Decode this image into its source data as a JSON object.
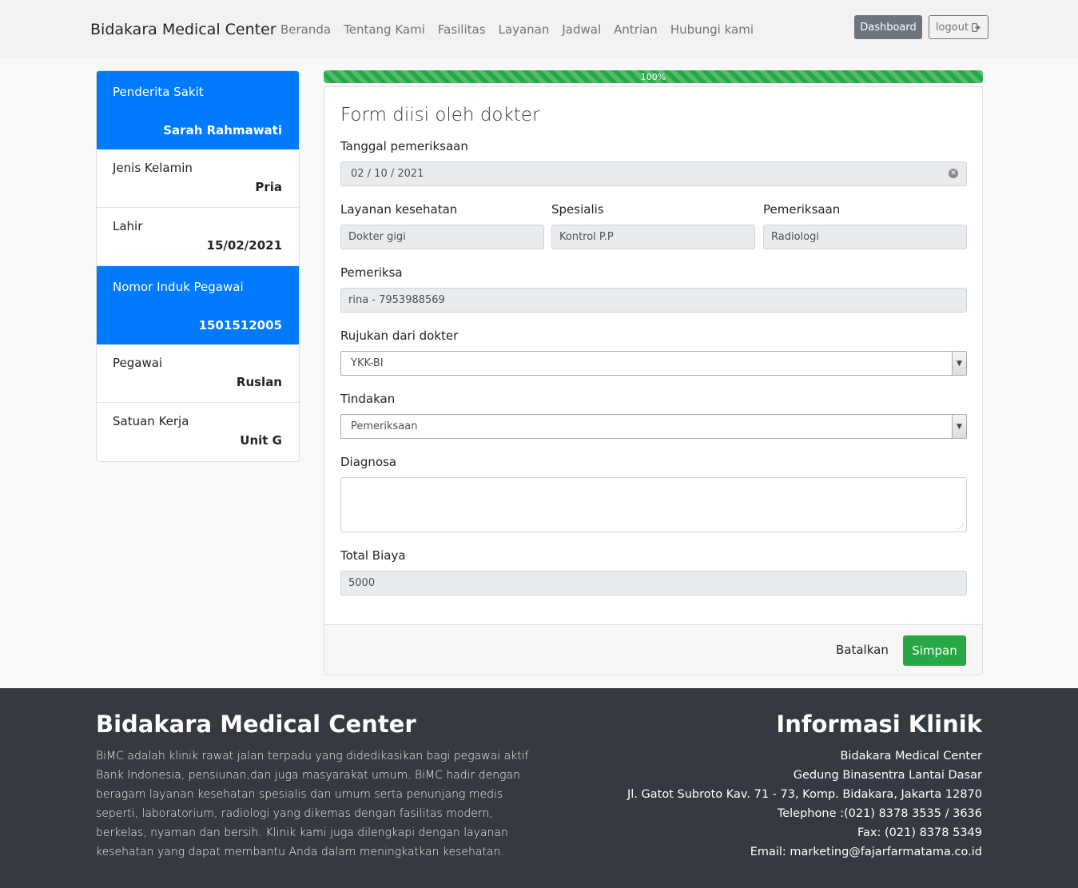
{
  "navbar": {
    "brand": "Bidakara Medical Center",
    "links": [
      "Beranda",
      "Tentang Kami",
      "Fasilitas",
      "Layanan",
      "Jadwal",
      "Antrian",
      "Hubungi kami"
    ],
    "dashboard_label": "Dashboard",
    "logout_label": "logout",
    "logout_icon": "sign-out-icon"
  },
  "sidebar": {
    "patient_label": "Penderita Sakit",
    "patient_value": "Sarah Rahmawati",
    "gender_label": "Jenis Kelamin",
    "gender_value": "Pria",
    "birth_label": "Lahir",
    "birth_value": "15/02/2021",
    "nip_label": "Nomor Induk Pegawai",
    "nip_value": "1501512005",
    "employee_label": "Pegawai",
    "employee_value": "Ruslan",
    "unit_label": "Satuan Kerja",
    "unit_value": "Unit G"
  },
  "progress": {
    "value": 100,
    "label": "100%"
  },
  "form": {
    "title": "Form diisi oleh dokter",
    "exam_date_label": "Tanggal pemeriksaan",
    "exam_date_value": "02 / 10 / 2021",
    "service_label": "Layanan kesehatan",
    "service_value": "Dokter gigi",
    "specialist_label": "Spesialis",
    "specialist_value": "Kontrol P.P",
    "examination_label": "Pemeriksaan",
    "examination_value": "Radiologi",
    "examiner_label": "Pemeriksa",
    "examiner_value": "rina - 7953988569",
    "referral_label": "Rujukan dari dokter",
    "referral_value": "YKK-BI",
    "action_label": "Tindakan",
    "action_value": "Pemeriksaan",
    "diagnosis_label": "Diagnosa",
    "diagnosis_value": "",
    "cost_label": "Total Biaya",
    "cost_value": "5000",
    "cancel_label": "Batalkan",
    "save_label": "Simpan"
  },
  "footer": {
    "left_title": "Bidakara Medical Center",
    "description": "BiMC adalah klinik rawat jalan terpadu yang didedikasikan bagi pegawai aktif Bank Indonesia, pensiunan,dan juga masyarakat umum. BiMC hadir dengan beragam layanan kesehatan spesialis dan umum serta penunjang medis seperti, laboratorium, radiologi yang dikemas dengan fasilitas modern, berkelas, nyaman dan bersih. Klinik kami juga dilengkapi dengan layanan kesehatan yang dapat membantu Anda dalam meningkatkan kesehatan.",
    "right_title": "Informasi Klinik",
    "info_lines": [
      "Bidakara Medical Center",
      "Gedung Binasentra Lantai Dasar",
      "Jl. Gatot Subroto Kav. 71 - 73, Komp. Bidakara, Jakarta 12870",
      "Telephone :(021) 8378 3535 / 3636",
      "Fax: (021) 8378 5349",
      "Email: marketing@fajarfarmatama.co.id"
    ]
  },
  "colors": {
    "primary": "#007bff",
    "success": "#28a745",
    "secondary": "#6c757d",
    "footer_bg": "#343a40"
  }
}
